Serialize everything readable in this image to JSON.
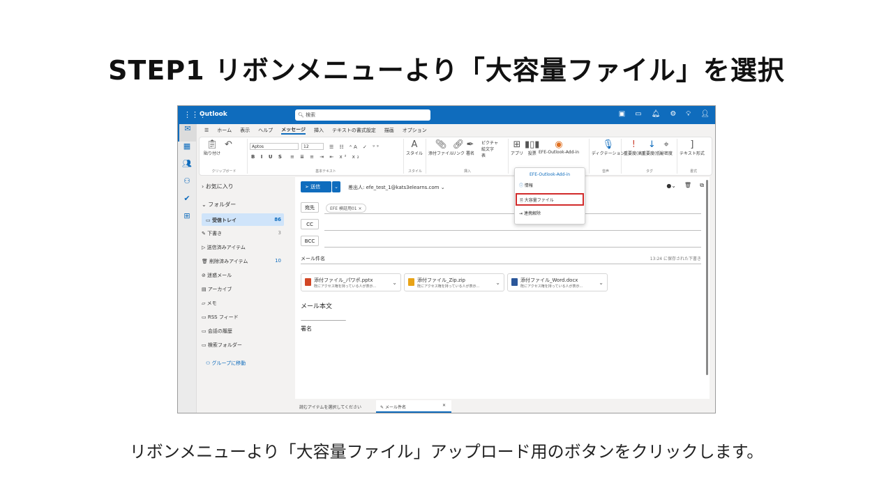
{
  "slide": {
    "title": "STEP1 リボンメニューより「大容量ファイル」を選択",
    "caption": "リボンメニューより「大容量ファイル」アップロード用のボタンをクリックします。"
  },
  "app": {
    "name": "Outlook",
    "search_placeholder": "検索"
  },
  "tabs": [
    "ホーム",
    "表示",
    "ヘルプ",
    "メッセージ",
    "挿入",
    "テキストの書式設定",
    "描画",
    "オプション"
  ],
  "selected_tab": "メッセージ",
  "ribbon": {
    "clipboard": {
      "paste": "貼り付け",
      "label": "クリップボード"
    },
    "font": {
      "name": "Aptos",
      "size": "12",
      "label": "基本テキスト",
      "buttons": "B I U S"
    },
    "style": {
      "label": "スタイル",
      "button": "スタイル"
    },
    "insert": {
      "attach": "添付ファイル",
      "link": "リンク",
      "signature": "署名",
      "picture": "ピクチャ",
      "emoji": "絵文字",
      "table": "表",
      "label": "挿入"
    },
    "apps": {
      "apps": "アプリ",
      "poll": "投票",
      "addin": "EFE-Outlook-Add-in"
    },
    "voice": {
      "dictate": "ディクテーション",
      "label": "音声"
    },
    "tags": {
      "imp_high": "重要度(高)",
      "imp_low": "重要度(低)",
      "sensitivity": "秘密度",
      "label": "タグ"
    },
    "format": {
      "text": "テキスト形式",
      "label": "書式"
    }
  },
  "nav": {
    "favorites": "お気に入り",
    "folders": "フォルダー",
    "items": [
      {
        "label": "受信トレイ",
        "count": "86"
      },
      {
        "label": "下書き",
        "count": "3"
      },
      {
        "label": "送信済みアイテム",
        "count": ""
      },
      {
        "label": "削除済みアイテム",
        "count": "10"
      },
      {
        "label": "迷惑メール",
        "count": ""
      },
      {
        "label": "アーカイブ",
        "count": ""
      },
      {
        "label": "メモ",
        "count": ""
      },
      {
        "label": "RSS フィード",
        "count": ""
      },
      {
        "label": "会話の履歴",
        "count": ""
      },
      {
        "label": "検索フォルダー",
        "count": ""
      }
    ],
    "move_to_group": "グループに移動"
  },
  "compose": {
    "send": "送信",
    "from": "差出人: efe_test_1@kats3elearns.com",
    "to_label": "宛先",
    "to_chip": "EFE 検証用01 ×",
    "cc_label": "CC",
    "bcc_label": "BCC",
    "subject": "メール件名",
    "saved": "13:24 に保存された下書き",
    "attachments": [
      {
        "name": "添付ファイル_パワポ.pptx",
        "desc": "既にアクセス権を持っている人が表示..."
      },
      {
        "name": "添付ファイル_Zip.zip",
        "desc": "既にアクセス権を持っている人が表示..."
      },
      {
        "name": "添付ファイル_Word.docx",
        "desc": "既にアクセス権を持っている人が表示..."
      }
    ],
    "body": "メール本文",
    "separator": "-------------------------------------------------------",
    "signature": "署名"
  },
  "popup": {
    "header": "EFE-Outlook-Add-in",
    "info": "情報",
    "large_file": "大容量ファイル",
    "disconnect": "連携解除"
  },
  "status": {
    "read_prompt": "読むアイテムを選択してください",
    "tab_label": "メール件名"
  },
  "colors": {
    "brand": "#0f6cbd",
    "highlight": "#d12a2a"
  }
}
